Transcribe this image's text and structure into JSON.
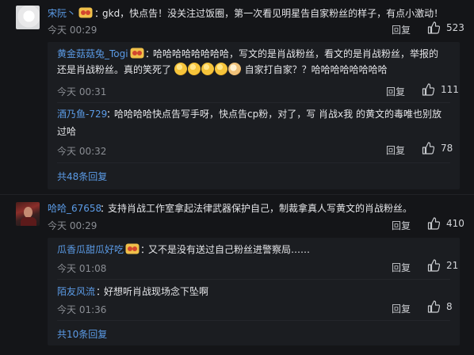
{
  "comments": [
    {
      "user": "宋阮丶",
      "text": "gkd，快点告！没关注过饭圈，第一次看见明星告自家粉丝的样子，有点小激动！",
      "time": "今天 00:29",
      "reply_label": "回复",
      "likes": "523",
      "avatar_icon": "avatar-white",
      "replies": [
        {
          "user": "黄金菇菇兔_Togi",
          "text_a": "哈哈哈哈哈哈哈哈，写文的是肖战粉丝，看文的是肖战粉丝，举报的",
          "text_b1": "还是肖战粉丝。真的笑死了",
          "text_b2": "自家打自家？？哈哈哈哈哈哈哈哈",
          "time": "今天 00:31",
          "reply_label": "回复",
          "likes": "111"
        },
        {
          "user": "酒乃鱼-729",
          "text_a": "哈哈哈哈快点告写手呀，快点告cp粉，对了，写 肖战x我 的黄文的毒唯也别放",
          "text_b": "过哈",
          "time": "今天 00:32",
          "reply_label": "回复",
          "likes": "78"
        }
      ],
      "more_label": "共48条回复"
    },
    {
      "user": "哈哈_67658",
      "text": "支持肖战工作室拿起法律武器保护自己，制裁拿真人写黄文的肖战粉丝。",
      "time": "今天 00:29",
      "reply_label": "回复",
      "likes": "410",
      "avatar_icon": "avatar-portrait",
      "replies": [
        {
          "user": "瓜香瓜甜瓜好吃",
          "text": "又不是没有送过自己粉丝进警察局……",
          "time": "今天 01:08",
          "reply_label": "回复",
          "likes": "21"
        },
        {
          "user": "陌友风流",
          "text": "好想听肖战现场念下坠啊",
          "time": "今天 01:36",
          "reply_label": "回复",
          "likes": "8"
        }
      ],
      "more_label": "共10条回复"
    }
  ],
  "separator": "：",
  "colors": {
    "link": "#5b9be6",
    "background": "#141518",
    "panel": "#1b1d21"
  }
}
